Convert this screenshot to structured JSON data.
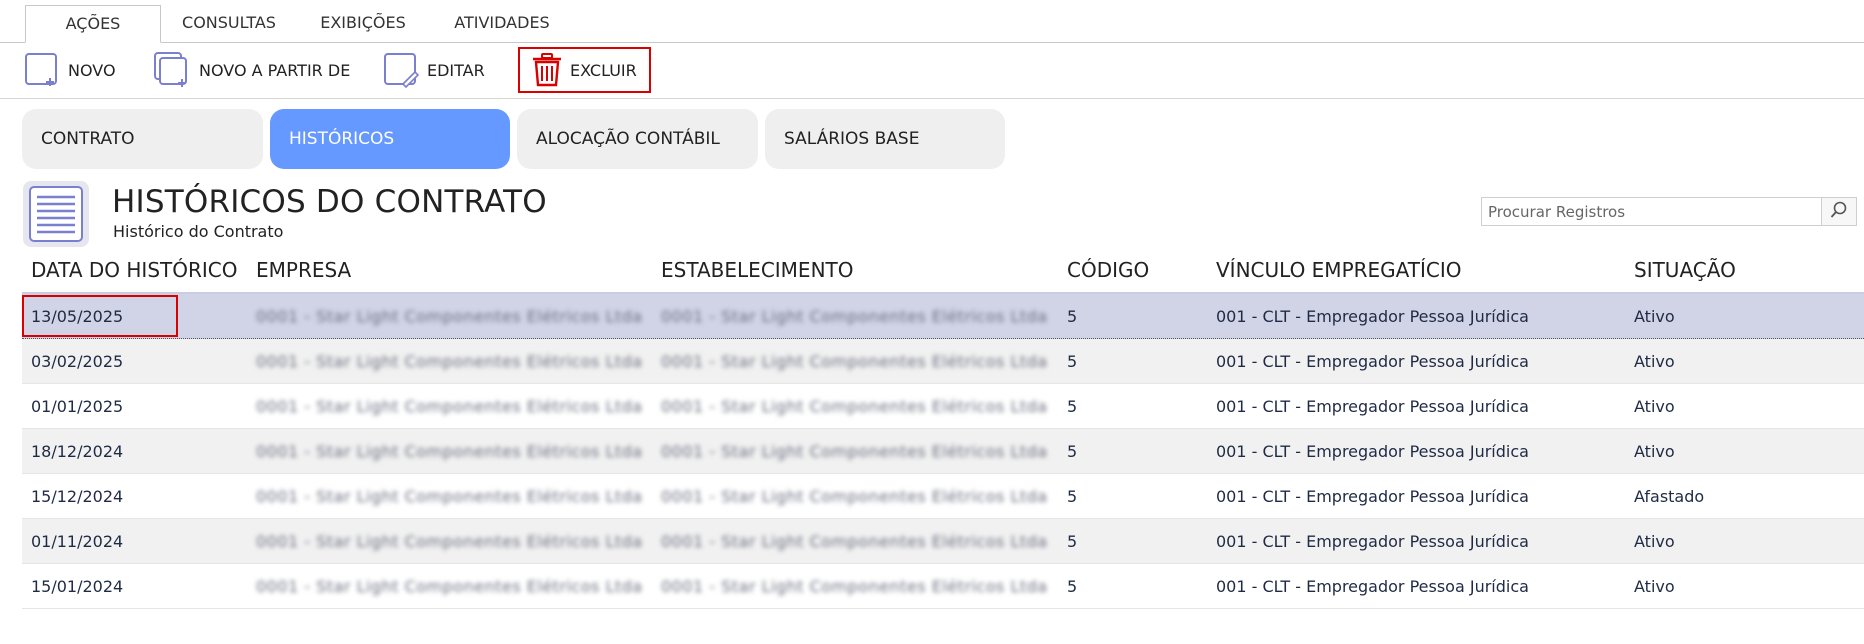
{
  "menu": {
    "tabs": [
      {
        "label": "AÇÕES",
        "active": true
      },
      {
        "label": "CONSULTAS",
        "active": false
      },
      {
        "label": "EXIBIÇÕES",
        "active": false
      },
      {
        "label": "ATIVIDADES",
        "active": false
      }
    ]
  },
  "toolbar": {
    "new_label": "NOVO",
    "new_from_label": "NOVO A PARTIR DE",
    "edit_label": "EDITAR",
    "delete_label": "EXCLUIR"
  },
  "sections": {
    "items": [
      {
        "label": "CONTRATO",
        "active": false
      },
      {
        "label": "HISTÓRICOS",
        "active": true
      },
      {
        "label": "ALOCAÇÃO CONTÁBIL",
        "active": false
      },
      {
        "label": "SALÁRIOS BASE",
        "active": false
      }
    ]
  },
  "header": {
    "title": "HISTÓRICOS DO CONTRATO",
    "subtitle": "Histórico do Contrato"
  },
  "search": {
    "placeholder": "Procurar Registros",
    "value": ""
  },
  "colors": {
    "accent": "#6699ff",
    "highlight": "#d90000",
    "selected_row": "#d1d3e6"
  },
  "table": {
    "columns": [
      "DATA DO HISTÓRICO",
      "EMPRESA",
      "ESTABELECIMENTO",
      "CÓDIGO",
      "VÍNCULO EMPREGATÍCIO",
      "SITUAÇÃO"
    ],
    "rows": [
      {
        "date": "13/05/2025",
        "empresa": "0001 - Star Light Componentes Elétricos Ltda",
        "estabelecimento": "0001 - Star Light Componentes Elétricos Ltda",
        "codigo": "5",
        "vinculo": "001 - CLT - Empregador Pessoa Jurídica",
        "situacao": "Ativo",
        "selected": true
      },
      {
        "date": "03/02/2025",
        "empresa": "0001 - Star Light Componentes Elétricos Ltda",
        "estabelecimento": "0001 - Star Light Componentes Elétricos Ltda",
        "codigo": "5",
        "vinculo": "001 - CLT - Empregador Pessoa Jurídica",
        "situacao": "Ativo",
        "selected": false
      },
      {
        "date": "01/01/2025",
        "empresa": "0001 - Star Light Componentes Elétricos Ltda",
        "estabelecimento": "0001 - Star Light Componentes Elétricos Ltda",
        "codigo": "5",
        "vinculo": "001 - CLT - Empregador Pessoa Jurídica",
        "situacao": "Ativo",
        "selected": false
      },
      {
        "date": "18/12/2024",
        "empresa": "0001 - Star Light Componentes Elétricos Ltda",
        "estabelecimento": "0001 - Star Light Componentes Elétricos Ltda",
        "codigo": "5",
        "vinculo": "001 - CLT - Empregador Pessoa Jurídica",
        "situacao": "Ativo",
        "selected": false
      },
      {
        "date": "15/12/2024",
        "empresa": "0001 - Star Light Componentes Elétricos Ltda",
        "estabelecimento": "0001 - Star Light Componentes Elétricos Ltda",
        "codigo": "5",
        "vinculo": "001 - CLT - Empregador Pessoa Jurídica",
        "situacao": "Afastado",
        "selected": false
      },
      {
        "date": "01/11/2024",
        "empresa": "0001 - Star Light Componentes Elétricos Ltda",
        "estabelecimento": "0001 - Star Light Componentes Elétricos Ltda",
        "codigo": "5",
        "vinculo": "001 - CLT - Empregador Pessoa Jurídica",
        "situacao": "Ativo",
        "selected": false
      },
      {
        "date": "15/01/2024",
        "empresa": "0001 - Star Light Componentes Elétricos Ltda",
        "estabelecimento": "0001 - Star Light Componentes Elétricos Ltda",
        "codigo": "5",
        "vinculo": "001 - CLT - Empregador Pessoa Jurídica",
        "situacao": "Ativo",
        "selected": false
      }
    ]
  }
}
